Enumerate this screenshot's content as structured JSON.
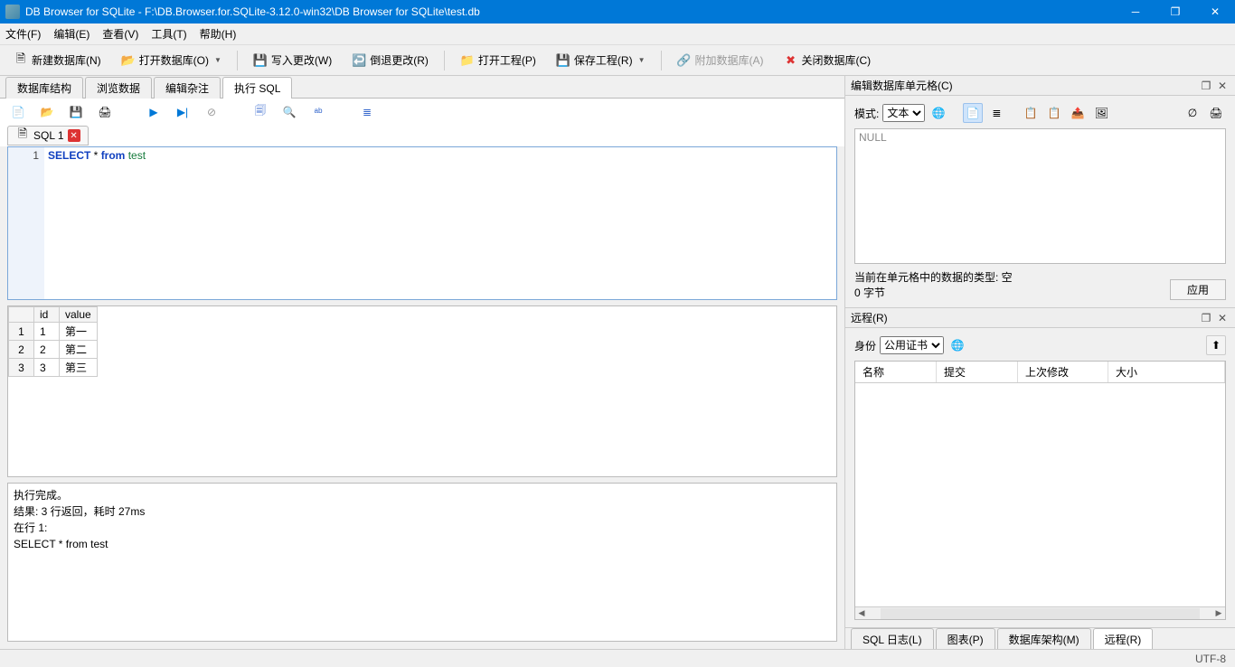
{
  "window": {
    "title": "DB Browser for SQLite - F:\\DB.Browser.for.SQLite-3.12.0-win32\\DB Browser for SQLite\\test.db"
  },
  "menu": {
    "file": "文件(F)",
    "edit": "编辑(E)",
    "view": "查看(V)",
    "tools": "工具(T)",
    "help": "帮助(H)"
  },
  "toolbar": {
    "new_db": "新建数据库(N)",
    "open_db": "打开数据库(O)",
    "write_changes": "写入更改(W)",
    "revert_changes": "倒退更改(R)",
    "open_project": "打开工程(P)",
    "save_project": "保存工程(R)",
    "attach_db": "附加数据库(A)",
    "close_db": "关闭数据库(C)"
  },
  "main_tabs": {
    "structure": "数据库结构",
    "browse": "浏览数据",
    "pragmas": "编辑杂注",
    "sql": "执行 SQL"
  },
  "sql": {
    "tab_label": "SQL 1",
    "line_number": "1",
    "code_kw1": "SELECT",
    "code_star": " * ",
    "code_kw2": "from",
    "code_id": " test"
  },
  "results": {
    "headers": {
      "blank": "",
      "id": "id",
      "value": "value"
    },
    "rows": [
      {
        "n": "1",
        "id": "1",
        "value": "第一"
      },
      {
        "n": "2",
        "id": "2",
        "value": "第二"
      },
      {
        "n": "3",
        "id": "3",
        "value": "第三"
      }
    ]
  },
  "log": {
    "line1": "执行完成。",
    "line2": "结果: 3 行返回，耗时 27ms",
    "line3": "在行 1:",
    "line4": "SELECT * from test"
  },
  "cell_editor": {
    "title": "编辑数据库单元格(C)",
    "mode_label": "模式:",
    "mode_value": "文本",
    "null_text": "NULL",
    "type_label": "当前在单元格中的数据的类型: 空",
    "size_label": "0 字节",
    "apply": "应用"
  },
  "remote": {
    "title": "远程(R)",
    "identity_label": "身份",
    "identity_value": "公用证书",
    "col_name": "名称",
    "col_commit": "提交",
    "col_modified": "上次修改",
    "col_size": "大小"
  },
  "bottom_tabs": {
    "sql_log": "SQL 日志(L)",
    "chart": "图表(P)",
    "schema": "数据库架构(M)",
    "remote": "远程(R)"
  },
  "status": {
    "encoding": "UTF-8"
  }
}
